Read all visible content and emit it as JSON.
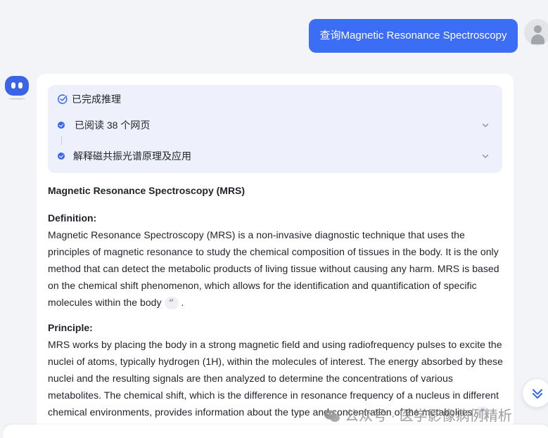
{
  "user_message": "查询Magnetic Resonance Spectroscopy",
  "reasoning": {
    "status": "已完成推理",
    "steps": [
      {
        "label": "已阅读 38 个网页"
      },
      {
        "label": "解释磁共振光谱原理及应用"
      }
    ]
  },
  "answer": {
    "title": "Magnetic Resonance Spectroscopy (MRS)",
    "definition_label": "Definition:",
    "definition_text": "Magnetic Resonance Spectroscopy (MRS) is a non-invasive diagnostic technique that uses the principles of magnetic resonance to study the chemical composition of tissues in the body. It is the only method that can detect the metabolic products of living tissue without causing any harm. MRS is based on the chemical shift phenomenon, which allows for the identification and quantification of specific molecules within the body",
    "definition_end": ".",
    "principle_label": "Principle:",
    "principle_text": "MRS works by placing the body in a strong magnetic field and using radiofrequency pulses to excite the nuclei of atoms, typically hydrogen (1H), within the molecules of interest. The energy absorbed by these nuclei and the resulting signals are then analyzed to determine the concentrations of various metabolites. The chemical shift, which is the difference in resonance frequency of a nucleus in different chemical environments, provides information about the type and concentration of the metabolites",
    "citation_glyph": "”"
  },
  "watermark": "公众号 · 医学影像病例精析",
  "colors": {
    "accent": "#3c6ef5",
    "card": "#ffffff",
    "background": "#f3f4f8"
  },
  "icons": [
    "user-avatar-icon",
    "bot-avatar-icon",
    "check-circle-icon",
    "chevron-down-icon",
    "scroll-down-icon",
    "wechat-icon"
  ]
}
